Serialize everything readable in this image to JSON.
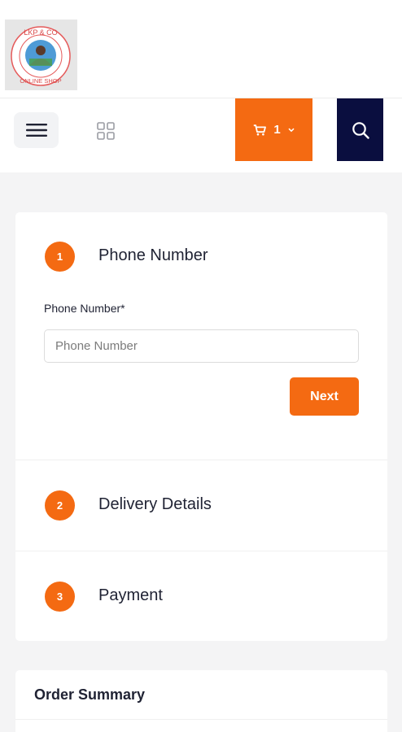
{
  "header": {
    "logo": {
      "alt": "LKP & CO ONLINE SHOP",
      "text_top": "LKP & CO",
      "text_bottom": "ONLINE SHOP"
    }
  },
  "navbar": {
    "menu_icon": "hamburger-icon",
    "grid_icon": "grid-icon",
    "cart": {
      "count": "1",
      "icon": "cart-icon",
      "chevron": "chevron-down-icon"
    },
    "search_icon": "search-icon"
  },
  "checkout": {
    "steps": [
      {
        "number": "1",
        "title": "Phone Number"
      },
      {
        "number": "2",
        "title": "Delivery Details"
      },
      {
        "number": "3",
        "title": "Payment"
      }
    ],
    "phone": {
      "label": "Phone Number*",
      "placeholder": "Phone Number",
      "value": ""
    },
    "next_label": "Next"
  },
  "summary": {
    "title": "Order Summary"
  },
  "colors": {
    "accent": "#f46a12",
    "search_bg": "#0a0e3f",
    "page_bg": "#f4f4f5"
  }
}
